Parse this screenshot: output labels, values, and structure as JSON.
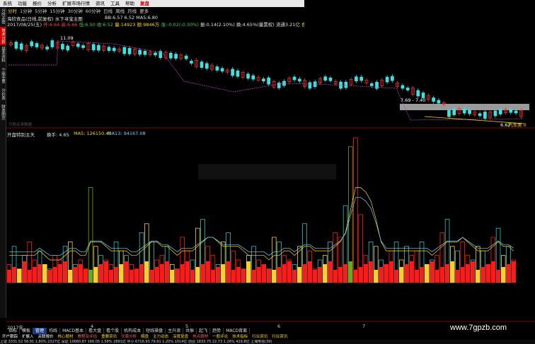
{
  "menu": [
    "系统",
    "功能",
    "报价",
    "分析",
    "扩展市场行情",
    "资讯",
    "工具",
    "帮助",
    "复盘"
  ],
  "periods": [
    "分时",
    "1分钟",
    "5分钟",
    "15分钟",
    "30分钟",
    "60分钟",
    "日线",
    "周线",
    "月线",
    "更多"
  ],
  "side_tabs": [
    "分时走势",
    "技术分析",
    "基本资料",
    "个股全景",
    "分价表",
    "财务图示"
  ],
  "header": {
    "line1": "海欣食品(日线,前复权) 水下寻宝主图",
    "line1_vals": "BB:6.57  6.52  MA5:6.80",
    "line2_date": "2017/08/25(五)",
    "line2_items": [
      "开:6.64",
      "高:6.66",
      "低:6.50",
      "收:6.52",
      "量:14923",
      "额:9846万",
      "涨:-0.02(-0.30%)",
      "振:0.14(2.10%)",
      "换:4.65%(量置权)",
      "流通3.21亿",
      "食品"
    ],
    "price_high_label": "11.09",
    "price_range_label": "7.69 - 7.40",
    "price_low_label": "6.62",
    "legend_right": "汽车类 0",
    "hint": "可购买来数据"
  },
  "sub": {
    "title": "开盘特别主天",
    "turnover": "换手: 4.65",
    "ma5": "MA5: 126150.40",
    "ma13": "MA13: 94167.08"
  },
  "axis": {
    "year": "2017年",
    "months": [
      "4",
      "5",
      "6",
      "7"
    ]
  },
  "bottom_tabs": [
    "指标",
    "模板",
    "管理",
    "均线",
    "MACD基本",
    "看大盘",
    "看个股",
    "机构成本",
    "短线操盘",
    "主升浪",
    "共振",
    "起飞",
    "趋势",
    "MACD背离"
  ],
  "bottom_tabs2": [
    "开户跟踪",
    "扩展入",
    "关联报价",
    "核心题材",
    "教程及评估",
    "重要资讯",
    "文章分析",
    "解盘",
    "主力动态",
    "深度复盘",
    "热点题材",
    "一般评论",
    "技术指标",
    "行业资讯",
    "行业资讯"
  ],
  "status": "上证 3331.52  58.91  1.80%  2327亿  深证 10680.87  166.05  1.58%  2891亿  中小 6716.93  79.91  1.20%  1014亿  创业 1833.75  22.73  1.26%  429.8亿  上海电信(39)",
  "watermark": "www.7gpzb.com",
  "chart_data": {
    "type": "bar",
    "price_candles_count": 100,
    "volume_bars": [
      4,
      8,
      3,
      6,
      9,
      5,
      7,
      4,
      3,
      6,
      5,
      8,
      9,
      4,
      5,
      3,
      21,
      8,
      6,
      5,
      4,
      9,
      7,
      6,
      4,
      3,
      11,
      13,
      9,
      5,
      6,
      8,
      4,
      3,
      10,
      7,
      5,
      12,
      14,
      8,
      6,
      4,
      9,
      11,
      7,
      5,
      3,
      6,
      8,
      5,
      4,
      3,
      10,
      9,
      6,
      5,
      4,
      8,
      13,
      7,
      3,
      5,
      6,
      9,
      11,
      10,
      17,
      30,
      32,
      15,
      6,
      9,
      8,
      5,
      4,
      7,
      9,
      5,
      8,
      6,
      7,
      9,
      4,
      5,
      6,
      11,
      14,
      8,
      7,
      9,
      6,
      5,
      8,
      7,
      4,
      10,
      12,
      6,
      8,
      5
    ],
    "volume_ma5": [
      6,
      6,
      6,
      6,
      6,
      6,
      7,
      6,
      5,
      5,
      5,
      6,
      7,
      7,
      6,
      6,
      9,
      9,
      9,
      8,
      7,
      7,
      7,
      7,
      6,
      6,
      7,
      8,
      9,
      9,
      8,
      8,
      7,
      6,
      7,
      7,
      7,
      8,
      9,
      10,
      10,
      9,
      8,
      8,
      8,
      8,
      7,
      6,
      6,
      6,
      6,
      5,
      6,
      6,
      7,
      7,
      6,
      7,
      8,
      8,
      7,
      7,
      7,
      7,
      8,
      9,
      11,
      16,
      21,
      21,
      20,
      18,
      14,
      9,
      7,
      7,
      7,
      7,
      7,
      7,
      7,
      7,
      7,
      6,
      7,
      8,
      9,
      9,
      9,
      10,
      9,
      8,
      7,
      7,
      7,
      8,
      9,
      8,
      8,
      7
    ]
  }
}
